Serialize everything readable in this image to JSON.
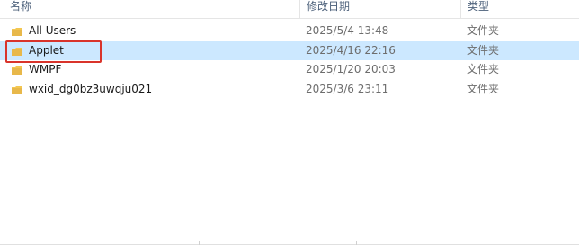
{
  "columns": {
    "name": "名称",
    "date": "修改日期",
    "type": "类型"
  },
  "rows": [
    {
      "name": "All Users",
      "date": "2025/5/4 13:48",
      "type": "文件夹",
      "icon": "folder-icon",
      "selected": false
    },
    {
      "name": "Applet",
      "date": "2025/4/16 22:16",
      "type": "文件夹",
      "icon": "folder-icon",
      "selected": true
    },
    {
      "name": "WMPF",
      "date": "2025/1/20 20:03",
      "type": "文件夹",
      "icon": "folder-icon",
      "selected": false
    },
    {
      "name": "wxid_dg0bz3uwqju021",
      "date": "2025/3/6 23:11",
      "type": "文件夹",
      "icon": "folder-icon",
      "selected": false
    }
  ],
  "colors": {
    "selection": "#cce8ff",
    "highlight_outline": "#d9342b",
    "folder": "#e8b84a"
  }
}
